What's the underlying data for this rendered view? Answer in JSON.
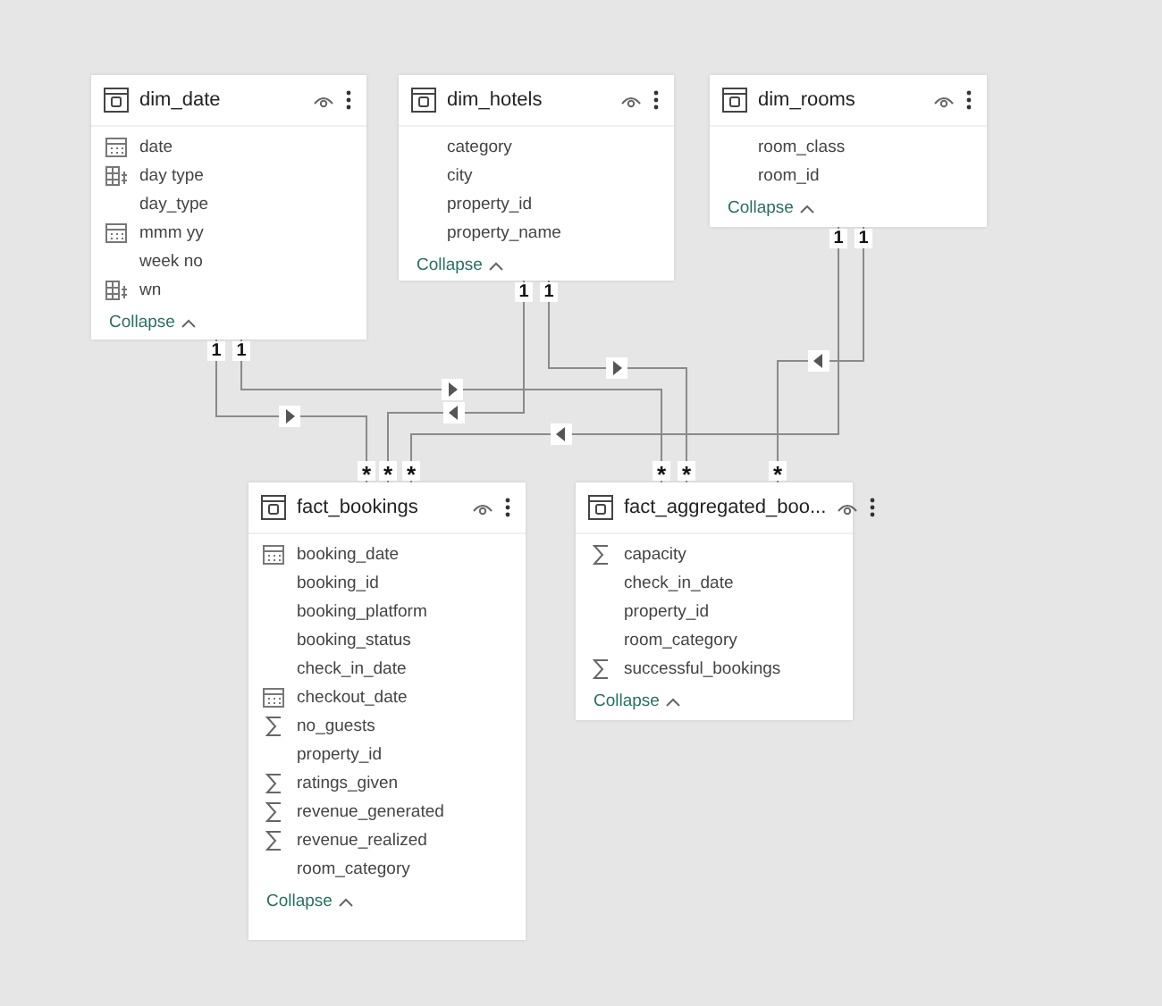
{
  "tables": [
    {
      "name": "dim_date",
      "columns": [
        {
          "name": "date",
          "kind": "date"
        },
        {
          "name": "day type",
          "kind": "hierarchy"
        },
        {
          "name": "day_type",
          "kind": "plain"
        },
        {
          "name": "mmm yy",
          "kind": "date"
        },
        {
          "name": "week no",
          "kind": "plain"
        },
        {
          "name": "wn",
          "kind": "hierarchy"
        }
      ],
      "collapse": "Collapse"
    },
    {
      "name": "dim_hotels",
      "columns": [
        {
          "name": "category",
          "kind": "plain"
        },
        {
          "name": "city",
          "kind": "plain"
        },
        {
          "name": "property_id",
          "kind": "plain"
        },
        {
          "name": "property_name",
          "kind": "plain"
        }
      ],
      "collapse": "Collapse"
    },
    {
      "name": "dim_rooms",
      "columns": [
        {
          "name": "room_class",
          "kind": "plain"
        },
        {
          "name": "room_id",
          "kind": "plain"
        }
      ],
      "collapse": "Collapse"
    },
    {
      "name": "fact_bookings",
      "columns": [
        {
          "name": "booking_date",
          "kind": "date"
        },
        {
          "name": "booking_id",
          "kind": "plain"
        },
        {
          "name": "booking_platform",
          "kind": "plain"
        },
        {
          "name": "booking_status",
          "kind": "plain"
        },
        {
          "name": "check_in_date",
          "kind": "plain"
        },
        {
          "name": "checkout_date",
          "kind": "date"
        },
        {
          "name": "no_guests",
          "kind": "sum"
        },
        {
          "name": "property_id",
          "kind": "plain"
        },
        {
          "name": "ratings_given",
          "kind": "sum"
        },
        {
          "name": "revenue_generated",
          "kind": "sum"
        },
        {
          "name": "revenue_realized",
          "kind": "sum"
        },
        {
          "name": "room_category",
          "kind": "plain"
        }
      ],
      "collapse": "Collapse"
    },
    {
      "name": "fact_aggregated_boo...",
      "columns": [
        {
          "name": "capacity",
          "kind": "sum"
        },
        {
          "name": "check_in_date",
          "kind": "plain"
        },
        {
          "name": "property_id",
          "kind": "plain"
        },
        {
          "name": "room_category",
          "kind": "plain"
        },
        {
          "name": "successful_bookings",
          "kind": "sum"
        }
      ],
      "collapse": "Collapse"
    }
  ],
  "relationships": [
    {
      "from_label": "1",
      "to_label": "*",
      "points_right": true
    },
    {
      "from_label": "1",
      "to_label": "*",
      "points_right": false
    },
    {
      "from_label": "1",
      "to_label": "*",
      "points_right": false
    },
    {
      "from_label": "1",
      "to_label": "*",
      "points_right": true
    },
    {
      "from_label": "1",
      "to_label": "*",
      "points_right": true
    },
    {
      "from_label": "1",
      "to_label": "*",
      "points_right": false
    }
  ]
}
